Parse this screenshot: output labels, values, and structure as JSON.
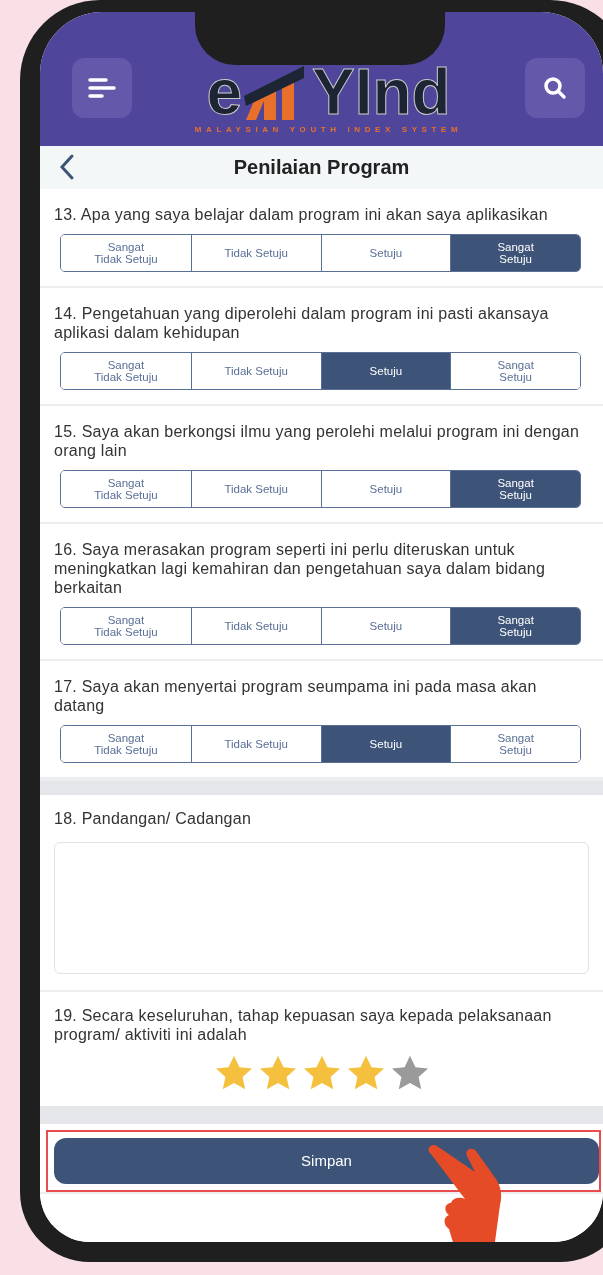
{
  "header": {
    "logo": {
      "left": "e",
      "right": "YInd",
      "tagline": "MALAYSIAN YOUTH INDEX SYSTEM"
    }
  },
  "nav": {
    "title": "Penilaian Program"
  },
  "questions": [
    {
      "text": "13. Apa yang saya belajar dalam program ini akan saya aplikasikan",
      "options": [
        {
          "label": "Sangat\nTidak Setuju",
          "selected": false
        },
        {
          "label": "Tidak Setuju",
          "selected": false
        },
        {
          "label": "Setuju",
          "selected": false
        },
        {
          "label": "Sangat\nSetuju",
          "selected": true
        }
      ]
    },
    {
      "text": "14. Pengetahuan yang diperolehi dalam program ini pasti akansaya aplikasi dalam kehidupan",
      "options": [
        {
          "label": "Sangat\nTidak Setuju",
          "selected": false
        },
        {
          "label": "Tidak Setuju",
          "selected": false
        },
        {
          "label": "Setuju",
          "selected": true
        },
        {
          "label": "Sangat\nSetuju",
          "selected": false
        }
      ]
    },
    {
      "text": "15. Saya akan berkongsi ilmu yang perolehi melalui program ini dengan orang lain",
      "options": [
        {
          "label": "Sangat\nTidak Setuju",
          "selected": false
        },
        {
          "label": "Tidak Setuju",
          "selected": false
        },
        {
          "label": "Setuju",
          "selected": false
        },
        {
          "label": "Sangat\nSetuju",
          "selected": true
        }
      ]
    },
    {
      "text": "16. Saya merasakan program seperti ini perlu diteruskan untuk meningkatkan lagi kemahiran dan pengetahuan saya dalam bidang berkaitan",
      "options": [
        {
          "label": "Sangat\nTidak Setuju",
          "selected": false
        },
        {
          "label": "Tidak Setuju",
          "selected": false
        },
        {
          "label": "Setuju",
          "selected": false
        },
        {
          "label": "Sangat\nSetuju",
          "selected": true
        }
      ]
    },
    {
      "text": "17. Saya akan menyertai program seumpama ini pada masa akan datang",
      "options": [
        {
          "label": "Sangat\nTidak Setuju",
          "selected": false
        },
        {
          "label": "Tidak Setuju",
          "selected": false
        },
        {
          "label": "Setuju",
          "selected": true
        },
        {
          "label": "Sangat\nSetuju",
          "selected": false
        }
      ]
    }
  ],
  "comment": {
    "label": "18. Pandangan/ Cadangan"
  },
  "rating": {
    "text": "19. Secara keseluruhan, tahap kepuasan saya kepada pelaksanaan program/ aktiviti ini adalah",
    "stars": 4
  },
  "save_button": "Simpan"
}
